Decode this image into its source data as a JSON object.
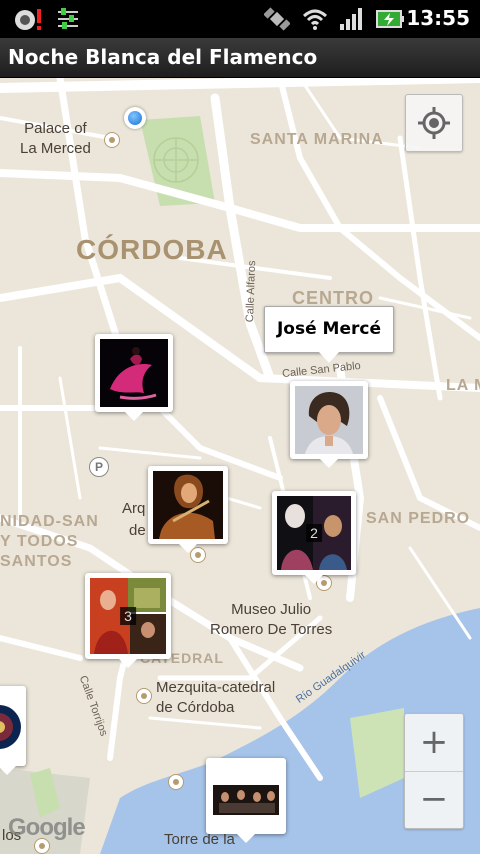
{
  "status_bar": {
    "time": "13:55",
    "icons": [
      "notification-alert-icon",
      "settings-sliders-icon",
      "satellite-icon",
      "wifi-icon",
      "signal-icon",
      "battery-charging-icon"
    ]
  },
  "app": {
    "title": "Noche Blanca del Flamenco"
  },
  "map": {
    "labels": {
      "palace": "Palace of\nLa Merced",
      "santa_marina": "SANTA MARINA",
      "cordoba": "CÓRDOBA",
      "centro": "CENTRO",
      "calle_alfaros": "Calle Alfaros",
      "calle_san_pablo": "Calle San Pablo",
      "la_m": "LA M",
      "arq": "Arq",
      "de": "de",
      "san_pedro": "SAN PEDRO",
      "nidad_san": "NIDAD-SAN\nY TODOS\nSANTOS",
      "museo": "Museo Julio\nRomero De Torres",
      "catedral": "CATEDRAL",
      "calle_torrijos": "Calle Torrijos",
      "mezquita": "Mezquita-catedral\nde Córdoba",
      "rio": "Río Guadalquivir",
      "torre": "Torre de la",
      "los": "los",
      "parking": "P",
      "google": "Google"
    },
    "bubble": {
      "title": "José Mercé"
    },
    "clusters": [
      {
        "name": "dancer-red-dress",
        "count": ""
      },
      {
        "name": "jose-merce",
        "count": ""
      },
      {
        "name": "guitarist-woman",
        "count": ""
      },
      {
        "name": "cluster-2",
        "count": "2"
      },
      {
        "name": "cluster-3",
        "count": "3"
      },
      {
        "name": "stage-group",
        "count": ""
      },
      {
        "name": "edge-marker",
        "count": ""
      }
    ],
    "controls": {
      "zoom_in": "+",
      "zoom_out": "−"
    }
  }
}
